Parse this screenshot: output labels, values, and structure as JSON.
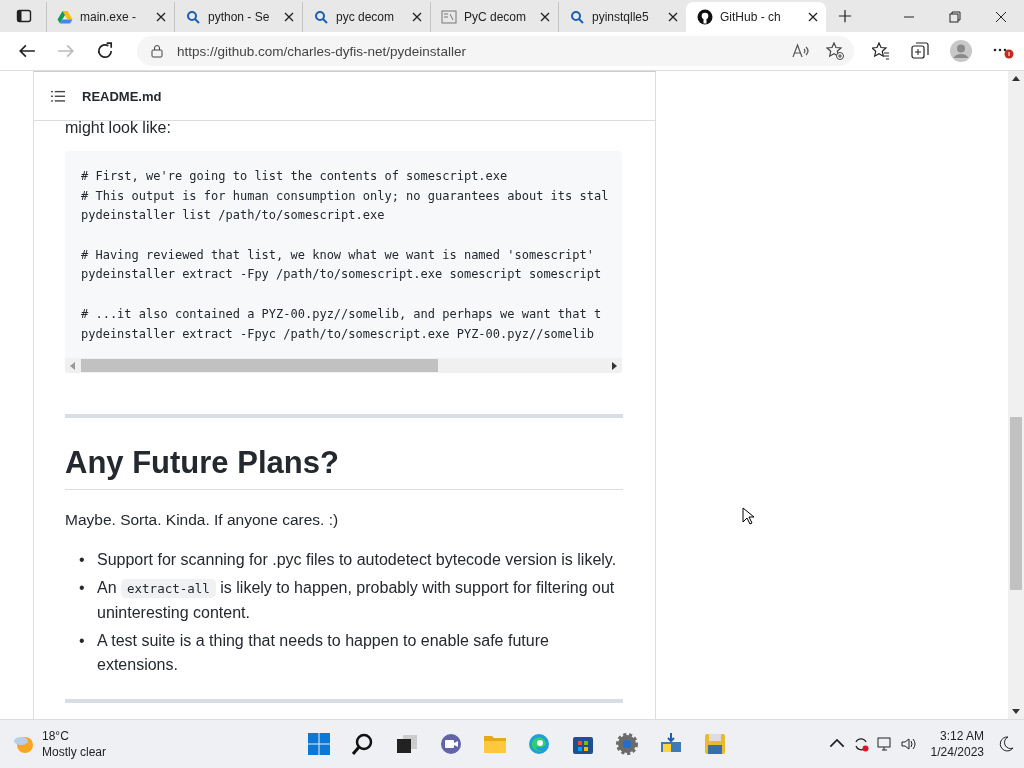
{
  "tabs": [
    {
      "kind": "drive",
      "label": "main.exe -",
      "selected": false
    },
    {
      "kind": "search",
      "label": "python - Se",
      "selected": false
    },
    {
      "kind": "search",
      "label": "pyc decom",
      "selected": false
    },
    {
      "kind": "doc",
      "label": "PyC decom",
      "selected": false
    },
    {
      "kind": "search",
      "label": "pyinstqlle5",
      "selected": false
    },
    {
      "kind": "github",
      "label": "GitHub - ch",
      "selected": true
    }
  ],
  "address_bar": {
    "url": "https://github.com/charles-dyfis-net/pydeinstaller"
  },
  "readme": {
    "title": "README.md",
    "intro": "might look like:",
    "code_groups": [
      [
        "# First, we're going to list the contents of somescript.exe",
        "# This output is for human consumption only; no guarantees about its stal",
        "pydeinstaller list /path/to/somescript.exe"
      ],
      [
        "# Having reviewed that list, we know what we want is named 'somescript'",
        "pydeinstaller extract -Fpy /path/to/somescript.exe somescript somescript"
      ],
      [
        "# ...it also contained a PYZ-00.pyz//somelib, and perhaps we want that t",
        "pydeinstaller extract -Fpyc /path/to/somescript.exe PYZ-00.pyz//somelib"
      ]
    ],
    "heading": "Any Future Plans?",
    "paragraph": "Maybe. Sorta. Kinda. If anyone cares. :)",
    "bullets": [
      {
        "marker": "•",
        "parts": [
          {
            "kind": "text",
            "text": "Support for scanning for .pyc files to autodetect bytecode version is likely."
          }
        ]
      },
      {
        "marker": "•",
        "parts": [
          {
            "kind": "text",
            "text": "An"
          },
          {
            "kind": "code",
            "text": "extract-all"
          },
          {
            "kind": "text",
            "text": "is likely to happen, probably with support for filtering out uninteresting content."
          }
        ]
      },
      {
        "marker": "•",
        "parts": [
          {
            "kind": "text",
            "text": "A test suite is a thing that needs to happen to enable safe future extensions."
          }
        ]
      }
    ]
  },
  "taskbar": {
    "temperature": "18°C",
    "weather": "Mostly clear",
    "time": "3:12 AM",
    "date": "1/24/2023"
  }
}
